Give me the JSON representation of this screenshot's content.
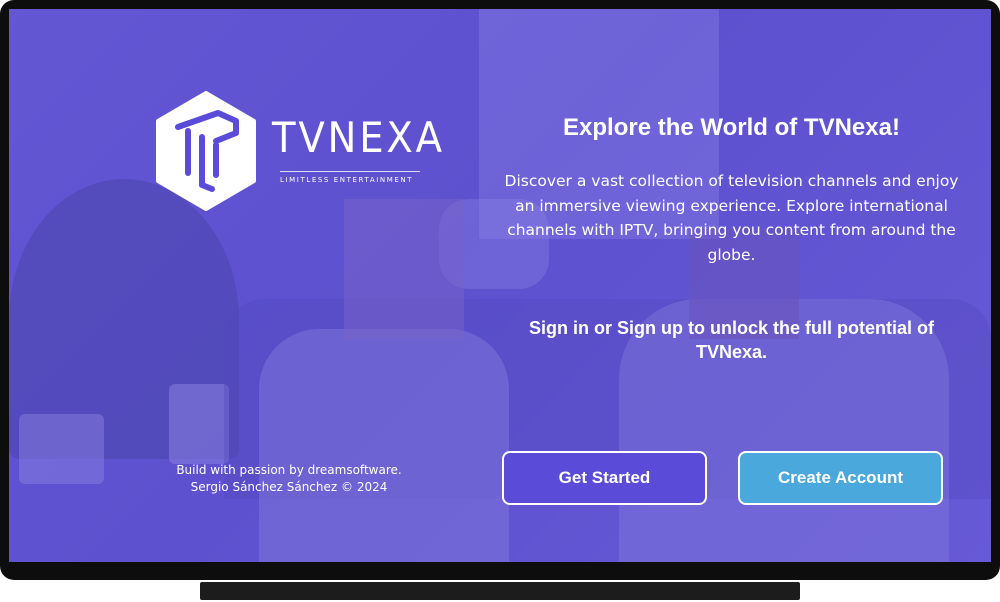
{
  "logo": {
    "name": "TVNEXA",
    "tagline": "LIMITLESS ENTERTAINMENT"
  },
  "hero": {
    "headline": "Explore the World of TVNexa!",
    "description": "Discover a vast collection of television channels and enjoy an immersive viewing experience. Explore international channels with IPTV, bringing you content from around the globe.",
    "cta_text": "Sign in or Sign up to unlock the full potential of TVNexa."
  },
  "buttons": {
    "get_started": "Get Started",
    "create_account": "Create Account"
  },
  "footer": {
    "credit_line1": "Build with passion by dreamsoftware.",
    "credit_line2": "Sergio Sánchez Sánchez © 2024"
  },
  "colors": {
    "overlay": "#5c50d2",
    "primary_button": "#5a4bd8",
    "secondary_button": "#4ba8dc",
    "text": "#ffffff",
    "tv_frame": "#0d0d0d"
  }
}
